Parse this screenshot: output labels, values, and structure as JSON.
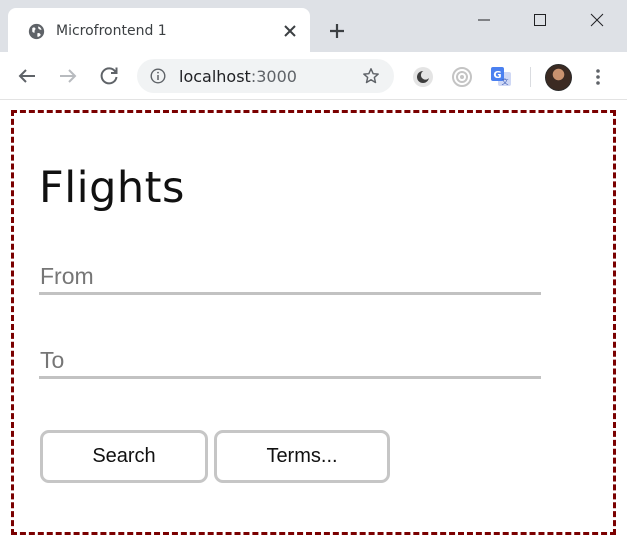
{
  "browser": {
    "tab": {
      "title": "Microfrontend 1"
    },
    "address": {
      "host": "localhost",
      "port": ":3000"
    }
  },
  "page": {
    "title": "Flights",
    "from_field": {
      "placeholder": "From",
      "value": ""
    },
    "to_field": {
      "placeholder": "To",
      "value": ""
    },
    "search_label": "Search",
    "terms_label": "Terms..."
  },
  "colors": {
    "frame_bg": "#dee1e6",
    "dashed_border": "#7a0000",
    "input_underline": "#c2c2c2",
    "button_border": "#c6c6c6"
  },
  "icons": [
    "globe-icon",
    "close-icon",
    "plus-icon",
    "minimize-icon",
    "maximize-icon",
    "window-close-icon",
    "back-arrow-icon",
    "forward-arrow-icon",
    "reload-icon",
    "info-icon",
    "star-icon",
    "dark-mode-extension-icon",
    "record-extension-icon",
    "translate-extension-icon",
    "avatar",
    "more-menu-icon"
  ]
}
